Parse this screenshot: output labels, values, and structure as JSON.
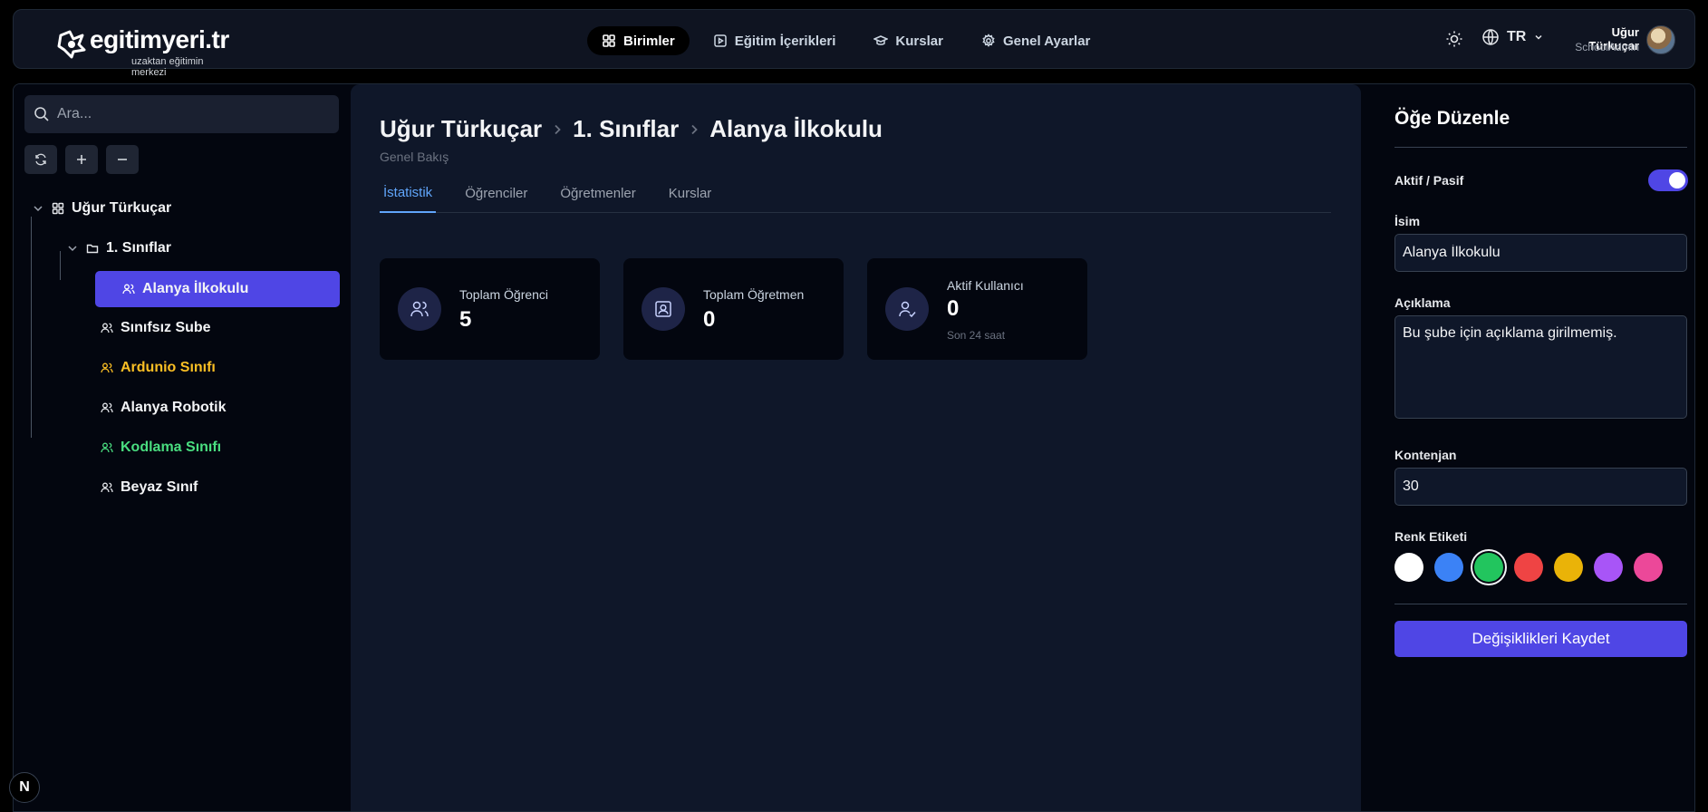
{
  "brand": {
    "name": "egitimyeri.tr",
    "tagline": "uzaktan eğitimin merkezi"
  },
  "nav": [
    {
      "label": "Birimler",
      "icon": "grid-icon",
      "active": true
    },
    {
      "label": "Eğitim İçerikleri",
      "icon": "play-square-icon",
      "active": false
    },
    {
      "label": "Kurslar",
      "icon": "graduation-cap-icon",
      "active": false
    },
    {
      "label": "Genel Ayarlar",
      "icon": "gear-icon",
      "active": false
    }
  ],
  "header": {
    "language": "TR",
    "user_name": "Uğur Türkuçar",
    "user_role": "SchoolAdmin"
  },
  "sidebar": {
    "search_placeholder": "Ara...",
    "tree": {
      "root": "Uğur Türkuçar",
      "folder": "1. Sınıflar",
      "selected": "Alanya İlkokulu",
      "items": [
        {
          "label": "Sınıfsız Sube",
          "color": "#f3f4f6"
        },
        {
          "label": "Ardunio Sınıfı",
          "color": "#fbbf24"
        },
        {
          "label": "Alanya Robotik",
          "color": "#f3f4f6"
        },
        {
          "label": "Kodlama Sınıfı",
          "color": "#4ade80"
        },
        {
          "label": "Beyaz Sınıf",
          "color": "#f3f4f6"
        }
      ]
    }
  },
  "main": {
    "breadcrumb": [
      "Uğur Türkuçar",
      "1. Sınıflar",
      "Alanya İlkokulu"
    ],
    "subtitle": "Genel Bakış",
    "tabs": [
      "İstatistik",
      "Öğrenciler",
      "Öğretmenler",
      "Kurslar"
    ],
    "stats": [
      {
        "label": "Toplam Öğrenci",
        "value": "5"
      },
      {
        "label": "Toplam Öğretmen",
        "value": "0"
      },
      {
        "label": "Aktif Kullanıcı",
        "value": "0",
        "note": "Son 24 saat"
      }
    ]
  },
  "panel": {
    "title": "Öğe Düzenle",
    "active_label": "Aktif / Pasif",
    "active": true,
    "name_label": "İsim",
    "name_value": "Alanya İlkokulu",
    "desc_label": "Açıklama",
    "desc_value": "Bu şube için açıklama girilmemiş.",
    "quota_label": "Kontenjan",
    "quota_value": "30",
    "color_label": "Renk Etiketi",
    "colors": [
      "#ffffff",
      "#3b82f6",
      "#22c55e",
      "#ef4444",
      "#eab308",
      "#a855f7",
      "#ec4899"
    ],
    "selected_color": "#22c55e",
    "save_label": "Değişiklikleri Kaydet"
  },
  "badge": "N"
}
